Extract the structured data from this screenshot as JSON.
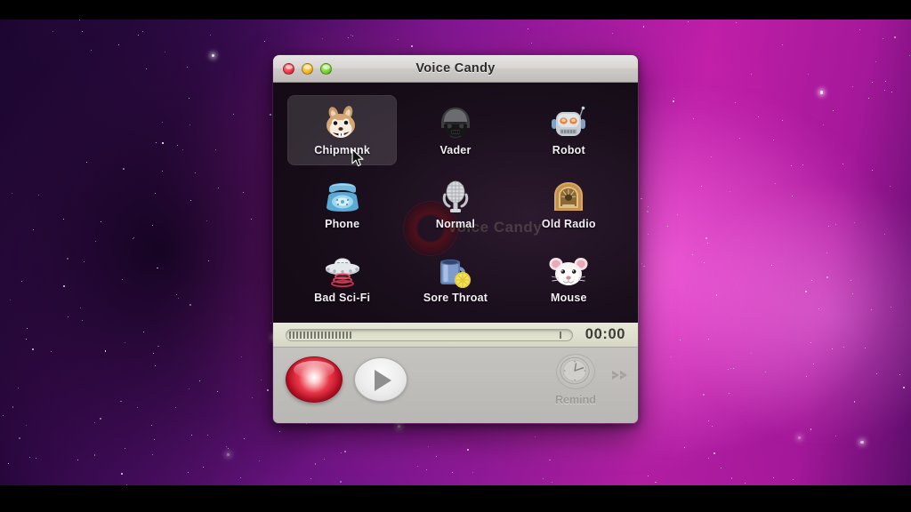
{
  "desktop": {
    "wallpaper_name": "aurora-nebula-wallpaper",
    "colors": {
      "magenta": "#c01fa8",
      "purple": "#79148f",
      "deep_violet": "#3a0a55",
      "letterbox": "#000000"
    }
  },
  "window": {
    "title": "Voice Candy",
    "traffic_lights": [
      {
        "name": "close-button",
        "color": "#e8344a"
      },
      {
        "name": "minimize-button",
        "color": "#f0b322"
      },
      {
        "name": "zoom-button",
        "color": "#73cc31"
      }
    ],
    "watermark": "Voice Candy"
  },
  "effects": {
    "selected": "Chipmunk",
    "items": [
      {
        "label": "Chipmunk",
        "icon": "chipmunk-icon",
        "selected": true
      },
      {
        "label": "Vader",
        "icon": "vader-helmet-icon",
        "selected": false
      },
      {
        "label": "Robot",
        "icon": "robot-head-icon",
        "selected": false
      },
      {
        "label": "Phone",
        "icon": "telephone-icon",
        "selected": false
      },
      {
        "label": "Normal",
        "icon": "microphone-icon",
        "selected": false
      },
      {
        "label": "Old Radio",
        "icon": "radio-icon",
        "selected": false
      },
      {
        "label": "Bad Sci-Fi",
        "icon": "ufo-icon",
        "selected": false
      },
      {
        "label": "Sore Throat",
        "icon": "mug-lemon-icon",
        "selected": false
      },
      {
        "label": "Mouse",
        "icon": "mouse-head-icon",
        "selected": false
      }
    ]
  },
  "transport": {
    "timer": "00:00",
    "meter_segments": 18,
    "record_label": "record-button",
    "play_label": "play-button",
    "remind_label": "Remind",
    "remind_enabled": false,
    "share_label": "share-arrow"
  }
}
